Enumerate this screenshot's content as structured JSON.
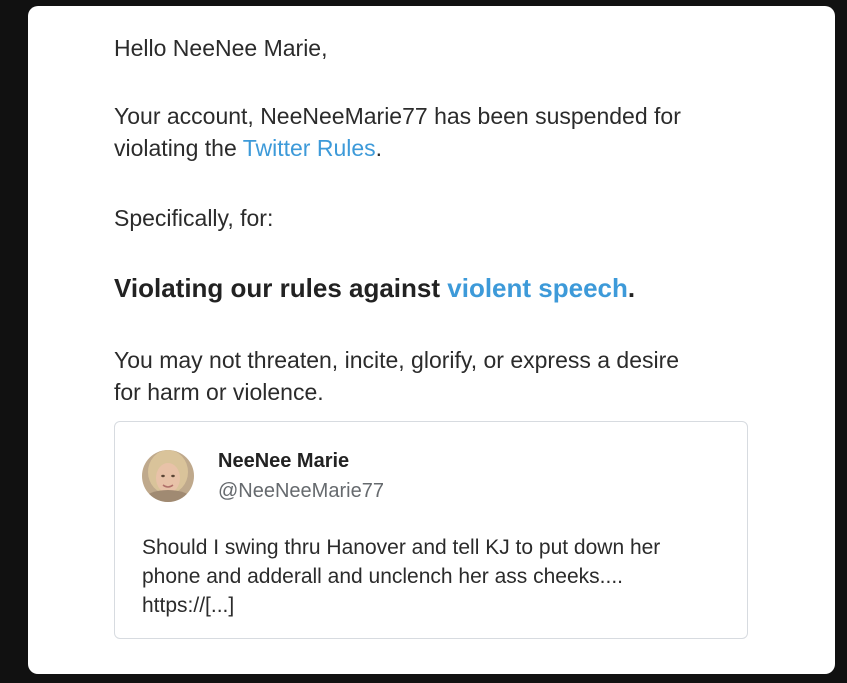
{
  "email": {
    "greeting": "Hello NeeNee Marie,",
    "suspension_line1": "Your account, NeeNeeMarie77 has been suspended for",
    "suspension_prefix": "violating the ",
    "rules_link": "Twitter Rules",
    "suspension_suffix": ".",
    "specifically": "Specifically, for:",
    "violation_prefix": "Violating our rules against ",
    "violation_link": "violent speech",
    "violation_suffix": ".",
    "rule_description_line1": "You may not threaten, incite, glorify, or express a desire",
    "rule_description_line2": "for harm or violence."
  },
  "tweet": {
    "author_name": "NeeNee Marie",
    "author_handle": "@NeeNeeMarie77",
    "text_line1": "Should I swing thru Hanover and tell KJ to put down her",
    "text_line2": "phone and adderall and unclench her ass cheeks....",
    "text_line3": "https://[...]"
  },
  "colors": {
    "link": "#3d9ad9",
    "text": "#2b2b2b",
    "handle": "#666a6e",
    "background": "#111111",
    "card": "#ffffff"
  }
}
